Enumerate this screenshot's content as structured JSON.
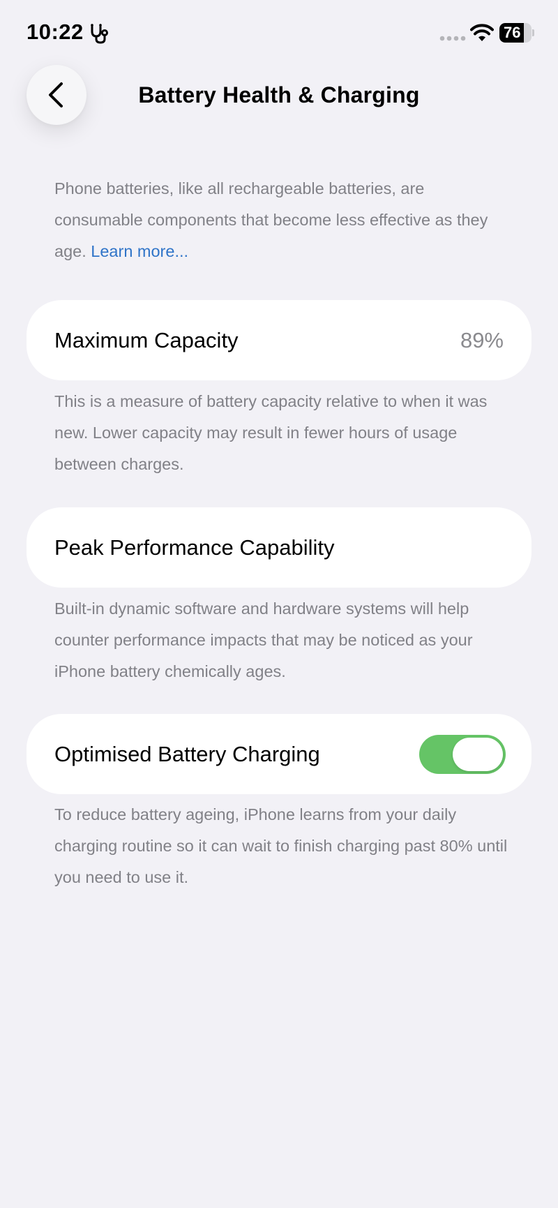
{
  "status_bar": {
    "time": "10:22",
    "battery_level": "76",
    "battery_fraction": 0.76,
    "activity_icon": "stethoscope-icon",
    "signal_icon": "signal-dots-icon",
    "wifi_icon": "wifi-icon"
  },
  "nav": {
    "back_icon": "chevron-left-icon",
    "title": "Battery Health & Charging"
  },
  "intro": {
    "text": "Phone batteries, like all rechargeable batteries, are consumable components that become less effective as they age. ",
    "link_label": "Learn more..."
  },
  "maximum_capacity": {
    "label": "Maximum Capacity",
    "value": "89%",
    "description": "This is a measure of battery capacity relative to when it was new. Lower capacity may result in fewer hours of usage between charges."
  },
  "peak_performance": {
    "label": "Peak Performance Capability",
    "description": "Built-in dynamic software and hardware systems will help counter performance impacts that may be noticed as your iPhone battery chemically ages."
  },
  "optimised_charging": {
    "label": "Optimised Battery Charging",
    "enabled": true,
    "description": "To reduce battery ageing, iPhone learns from your daily charging routine so it can wait to finish charging past 80% until you need to use it."
  },
  "colors": {
    "background": "#f2f1f6",
    "card": "#ffffff",
    "secondary_text": "#818187",
    "link": "#2f74c8",
    "toggle_on": "#65c466"
  }
}
